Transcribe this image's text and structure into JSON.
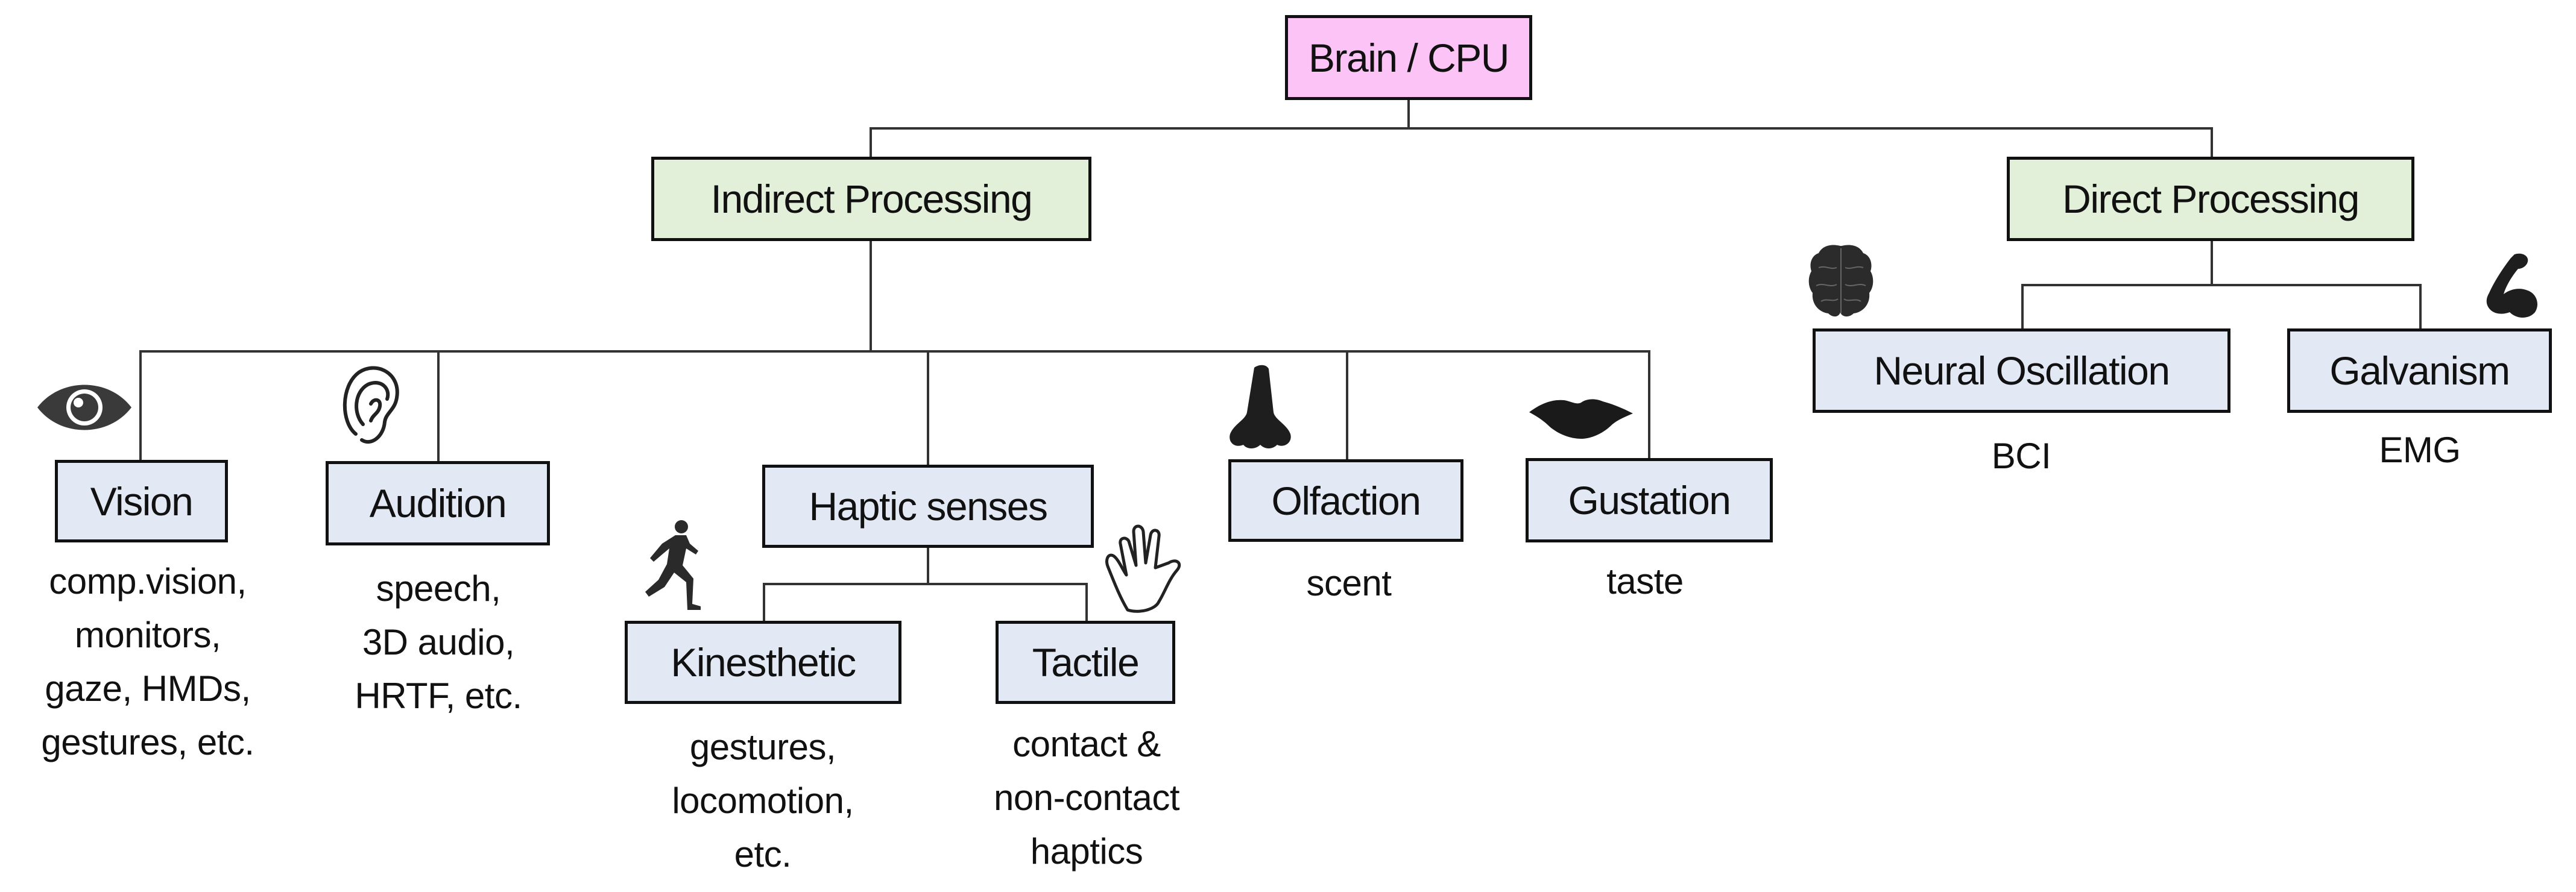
{
  "diagram": {
    "root": {
      "label": "Brain / CPU"
    },
    "branches": {
      "indirect": {
        "label": "Indirect Processing"
      },
      "direct": {
        "label": "Direct Processing"
      }
    },
    "indirect_children": [
      {
        "key": "vision",
        "label": "Vision",
        "icon": "eye-icon",
        "caption": [
          "comp.vision,",
          "monitors,",
          "gaze, HMDs,",
          "gestures, etc."
        ]
      },
      {
        "key": "audition",
        "label": "Audition",
        "icon": "ear-icon",
        "caption": [
          "speech,",
          "3D audio,",
          "HRTF, etc."
        ]
      },
      {
        "key": "haptic",
        "label": "Haptic senses",
        "icon": null,
        "caption": []
      },
      {
        "key": "olfaction",
        "label": "Olfaction",
        "icon": "nose-icon",
        "caption": [
          "scent"
        ]
      },
      {
        "key": "gustation",
        "label": "Gustation",
        "icon": "lips-icon",
        "caption": [
          "taste"
        ]
      }
    ],
    "haptic_children": [
      {
        "key": "kinesthetic",
        "label": "Kinesthetic",
        "icon": "runner-icon",
        "caption": [
          "gestures,",
          "locomotion,",
          "etc."
        ]
      },
      {
        "key": "tactile",
        "label": "Tactile",
        "icon": "hand-icon",
        "caption": [
          "contact &",
          "non-contact",
          "haptics"
        ]
      }
    ],
    "direct_children": [
      {
        "key": "neural",
        "label": "Neural Oscillation",
        "icon": "brain-icon",
        "caption": [
          "BCI"
        ]
      },
      {
        "key": "galvanism",
        "label": "Galvanism",
        "icon": "flexed-arm-icon",
        "caption": [
          "EMG"
        ]
      }
    ]
  },
  "colors": {
    "root_fill": "#fcc3f6",
    "branch_fill": "#e2efd9",
    "leaf_fill": "#e2e8f4",
    "border": "#111111",
    "connector": "#333333"
  }
}
